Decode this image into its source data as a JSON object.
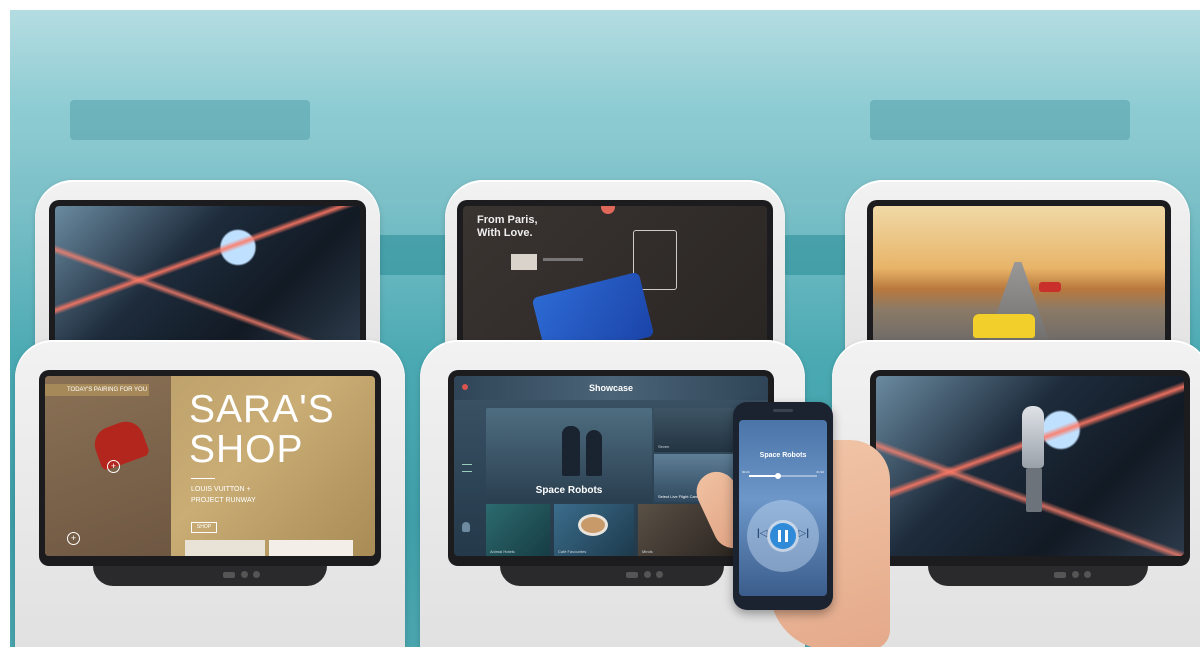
{
  "screens": {
    "paris": {
      "headline_line1": "From Paris,",
      "headline_line2": "With Love."
    },
    "sara_shop": {
      "tag": "TODAY'S PAIRING FOR YOU",
      "title_line1": "SARA'S",
      "title_line2": "SHOP",
      "subtitle_line1": "LOUIS VUITTON +",
      "subtitle_line2": "PROJECT RUNWAY",
      "shop_button": "SHOP"
    },
    "showcase": {
      "header": "Showcase",
      "featured_title": "Space Robots",
      "side_item_1": "Seven",
      "side_item_2": "Select Live Flight Camera",
      "tile_1": "Animal Hotels",
      "tile_2": "Café Favourites",
      "tile_3": "Minds"
    }
  },
  "phone": {
    "track_title": "Space Robots",
    "time_elapsed": "00:24",
    "time_total": "01:32",
    "progress": 0.42
  },
  "colors": {
    "cabin_teal": "#4aa9b2",
    "accent_blue": "#2f8ad8",
    "phone_bg": "#1b2230"
  }
}
